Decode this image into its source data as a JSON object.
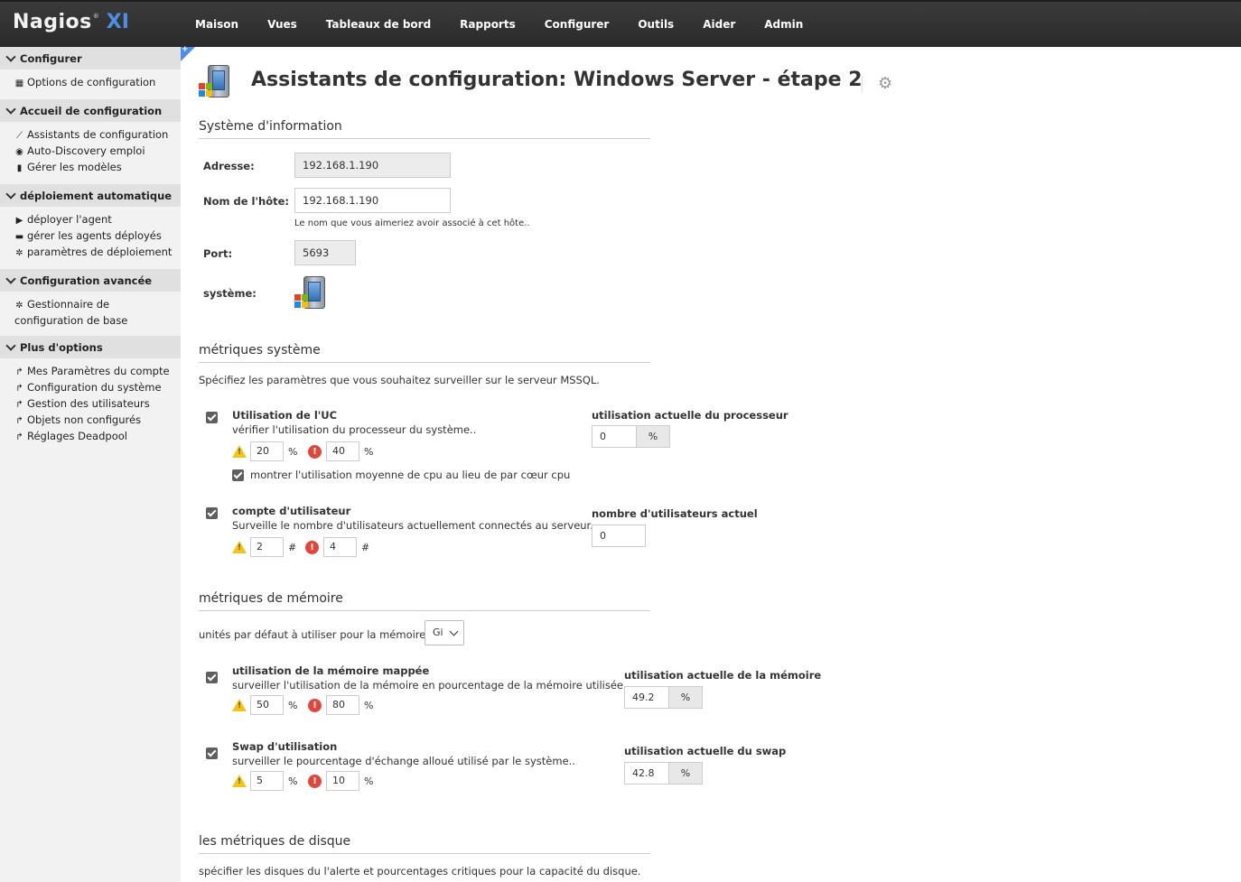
{
  "brand": {
    "name": "Nagios",
    "suffix": "XI",
    "reg": "®"
  },
  "nav": [
    "Maison",
    "Vues",
    "Tableaux de bord",
    "Rapports",
    "Configurer",
    "Outils",
    "Aider",
    "Admin"
  ],
  "sidebar": [
    {
      "title": "Configurer",
      "items": [
        {
          "icon": "grid-icon",
          "glyph": "■",
          "label": "Options de configuration"
        }
      ]
    },
    {
      "title": "Accueil de configuration",
      "items": [
        {
          "icon": "wand-icon",
          "glyph": "⟋",
          "label": "Assistants de configuration"
        },
        {
          "icon": "eye-icon",
          "glyph": "◉",
          "label": "Auto-Discovery emploi"
        },
        {
          "icon": "file-icon",
          "glyph": "▮",
          "label": "Gérer les modèles"
        }
      ]
    },
    {
      "title": "déploiement automatique",
      "items": [
        {
          "icon": "play-icon",
          "glyph": "▶",
          "label": "déployer l'agent"
        },
        {
          "icon": "folder-icon",
          "glyph": "▬",
          "label": "gérer les agents déployés"
        },
        {
          "icon": "gear-icon",
          "glyph": "✲",
          "label": "paramètres de déploiement"
        }
      ]
    },
    {
      "title": "Configuration avancée",
      "items": [
        {
          "icon": "gear-icon",
          "glyph": "✲",
          "label": "Gestionnaire de configuration de base"
        }
      ]
    },
    {
      "title": "Plus d'options",
      "items": [
        {
          "icon": "share-icon",
          "glyph": "↱",
          "label": "Mes Paramètres du compte"
        },
        {
          "icon": "share-icon",
          "glyph": "↱",
          "label": "Configuration du système"
        },
        {
          "icon": "share-icon",
          "glyph": "↱",
          "label": "Gestion des utilisateurs"
        },
        {
          "icon": "share-icon",
          "glyph": "↱",
          "label": "Objets non configurés"
        },
        {
          "icon": "share-icon",
          "glyph": "↱",
          "label": "Réglages Deadpool"
        }
      ]
    }
  ],
  "page": {
    "title": "Assistants de configuration: Windows Server - étape 2"
  },
  "info": {
    "section_title": "Système d'information",
    "address_label": "Adresse:",
    "address_value": "192.168.1.190",
    "hostname_label": "Nom de l'hôte:",
    "hostname_value": "192.168.1.190",
    "hostname_hint": "Le nom que vous aimeriez avoir associé à cet hôte..",
    "port_label": "Port:",
    "port_value": "5693",
    "system_label": "système:"
  },
  "system_metrics": {
    "section_title": "métriques système",
    "description": "Spécifiez les paramètres que vous souhaitez surveiller sur le serveur MSSQL.",
    "cpu": {
      "checked": true,
      "title": "Utilisation de l'UC",
      "desc": "vérifier l'utilisation du processeur du système..",
      "warn": "20",
      "warn_unit": "%",
      "crit": "40",
      "crit_unit": "%",
      "avg_checked": true,
      "avg_label": "montrer l'utilisation moyenne de cpu au lieu de par cœur cpu",
      "current_label": "utilisation actuelle du processeur",
      "current_value": "0",
      "current_unit": "%"
    },
    "users": {
      "checked": true,
      "title": "compte d'utilisateur",
      "desc": "Surveille le nombre d'utilisateurs actuellement connectés au serveur.",
      "warn": "2",
      "warn_unit": "#",
      "crit": "4",
      "crit_unit": "#",
      "current_label": "nombre d'utilisateurs actuel",
      "current_value": "0"
    }
  },
  "memory_metrics": {
    "section_title": "métriques de mémoire",
    "units_label": "unités par défaut à utiliser pour la mémoire:",
    "units_value": "Gi",
    "mapped": {
      "checked": true,
      "title": "utilisation de la mémoire mappée",
      "desc": "surveiller l'utilisation de la mémoire en pourcentage de la mémoire utilisée.",
      "warn": "50",
      "warn_unit": "%",
      "crit": "80",
      "crit_unit": "%",
      "current_label": "utilisation actuelle de la mémoire",
      "current_value": "49.2",
      "current_unit": "%"
    },
    "swap": {
      "checked": true,
      "title": "Swap d'utilisation",
      "desc": "surveiller le pourcentage d'échange alloué utilisé par le système..",
      "warn": "5",
      "warn_unit": "%",
      "crit": "10",
      "crit_unit": "%",
      "current_label": "utilisation actuelle du swap",
      "current_value": "42.8",
      "current_unit": "%"
    }
  },
  "disk_metrics": {
    "section_title": "les métriques de disque",
    "description": "spécifier les disques du l'alerte et pourcentages critiques pour la capacité du disque."
  }
}
